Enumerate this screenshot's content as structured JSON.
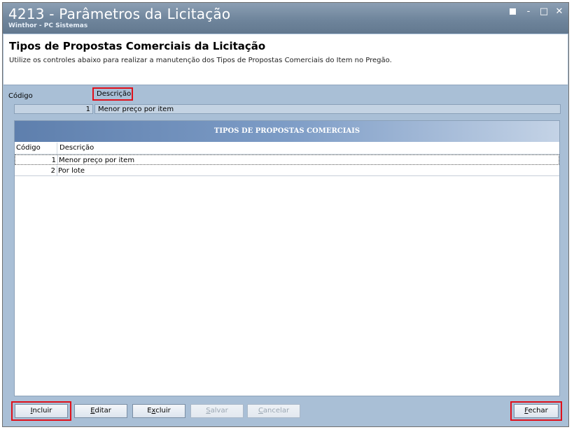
{
  "window": {
    "title": "4213 - Parâmetros da Licitação",
    "subtitle": "Winthor - PC Sistemas",
    "controls": {
      "restore": "restore-icon",
      "minimize": "-",
      "maximize": "□",
      "close": "✕"
    }
  },
  "header": {
    "title": "Tipos de Propostas Comerciais da Licitação",
    "description": "Utilize os controles abaixo para realizar a manutenção dos Tipos de Propostas Comerciais do Item no Pregão."
  },
  "form": {
    "codigo_label": "Código",
    "descricao_label": "Descrição",
    "codigo_value": "1",
    "descricao_value": "Menor preço por item"
  },
  "grid": {
    "banner": "TIPOS DE PROPOSTAS COMERCIAIS",
    "columns": {
      "codigo": "Código",
      "descricao": "Descrição"
    },
    "rows": [
      {
        "codigo": "1",
        "descricao": "Menor preço por item"
      },
      {
        "codigo": "2",
        "descricao": "Por lote"
      }
    ]
  },
  "buttons": {
    "incluir": {
      "first": "I",
      "rest": "ncluir"
    },
    "editar": {
      "first": "E",
      "rest": "ditar"
    },
    "excluir": {
      "pre": "E",
      "ul": "x",
      "rest": "cluir"
    },
    "salvar": {
      "first": "S",
      "rest": "alvar"
    },
    "cancelar": {
      "first": "C",
      "rest": "ancelar"
    },
    "fechar": {
      "first": "F",
      "rest": "echar"
    }
  },
  "colors": {
    "highlight": "#e0101a",
    "titlebar": "#6f859c",
    "body": "#a9bfd6"
  }
}
